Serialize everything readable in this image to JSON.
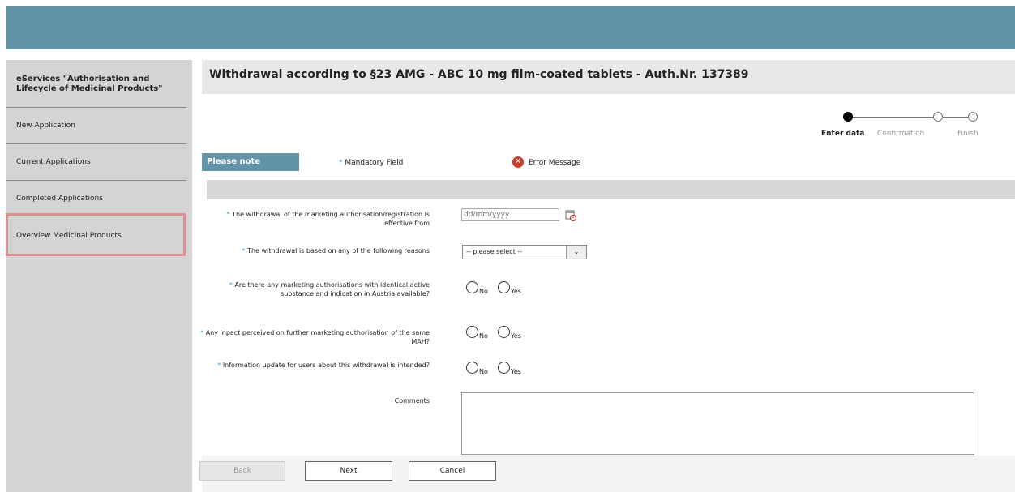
{
  "sidebar": {
    "title": "eServices \"Authorisation and Lifecycle of Medicinal Products\"",
    "items": [
      {
        "label": "New Application"
      },
      {
        "label": "Current Applications"
      },
      {
        "label": "Completed Applications"
      },
      {
        "label": "Overview Medicinal Products"
      }
    ]
  },
  "header": {
    "title": "Withdrawal according to §23 AMG - ABC 10 mg film-coated tablets - Auth.Nr. 137389"
  },
  "wizard": {
    "steps": [
      {
        "label": "Enter data"
      },
      {
        "label": "Confirmation"
      },
      {
        "label": "Finish"
      }
    ]
  },
  "notes": {
    "please_note": "Please note",
    "mandatory": "Mandatory Field",
    "error_message": "Error Message"
  },
  "form": {
    "date_label": "The withdrawal of the marketing authorisation/registration is effective from",
    "date_placeholder": "dd/mm/yyyy",
    "reason_label": "The withdrawal is based on any of the following reasons",
    "reason_select": "-- please select --",
    "identical_label": "Are there any marketing authorisations with identical active substance and indication in Austria available?",
    "impact_label": "Any inpact perceived on further marketing authorisation of the same MAH?",
    "info_label": "Information update for users about this withdrawal is intended?",
    "no_label": "No",
    "yes_label": "Yes",
    "comments_label": "Comments"
  },
  "buttons": {
    "back": "Back",
    "next": "Next",
    "cancel": "Cancel"
  }
}
